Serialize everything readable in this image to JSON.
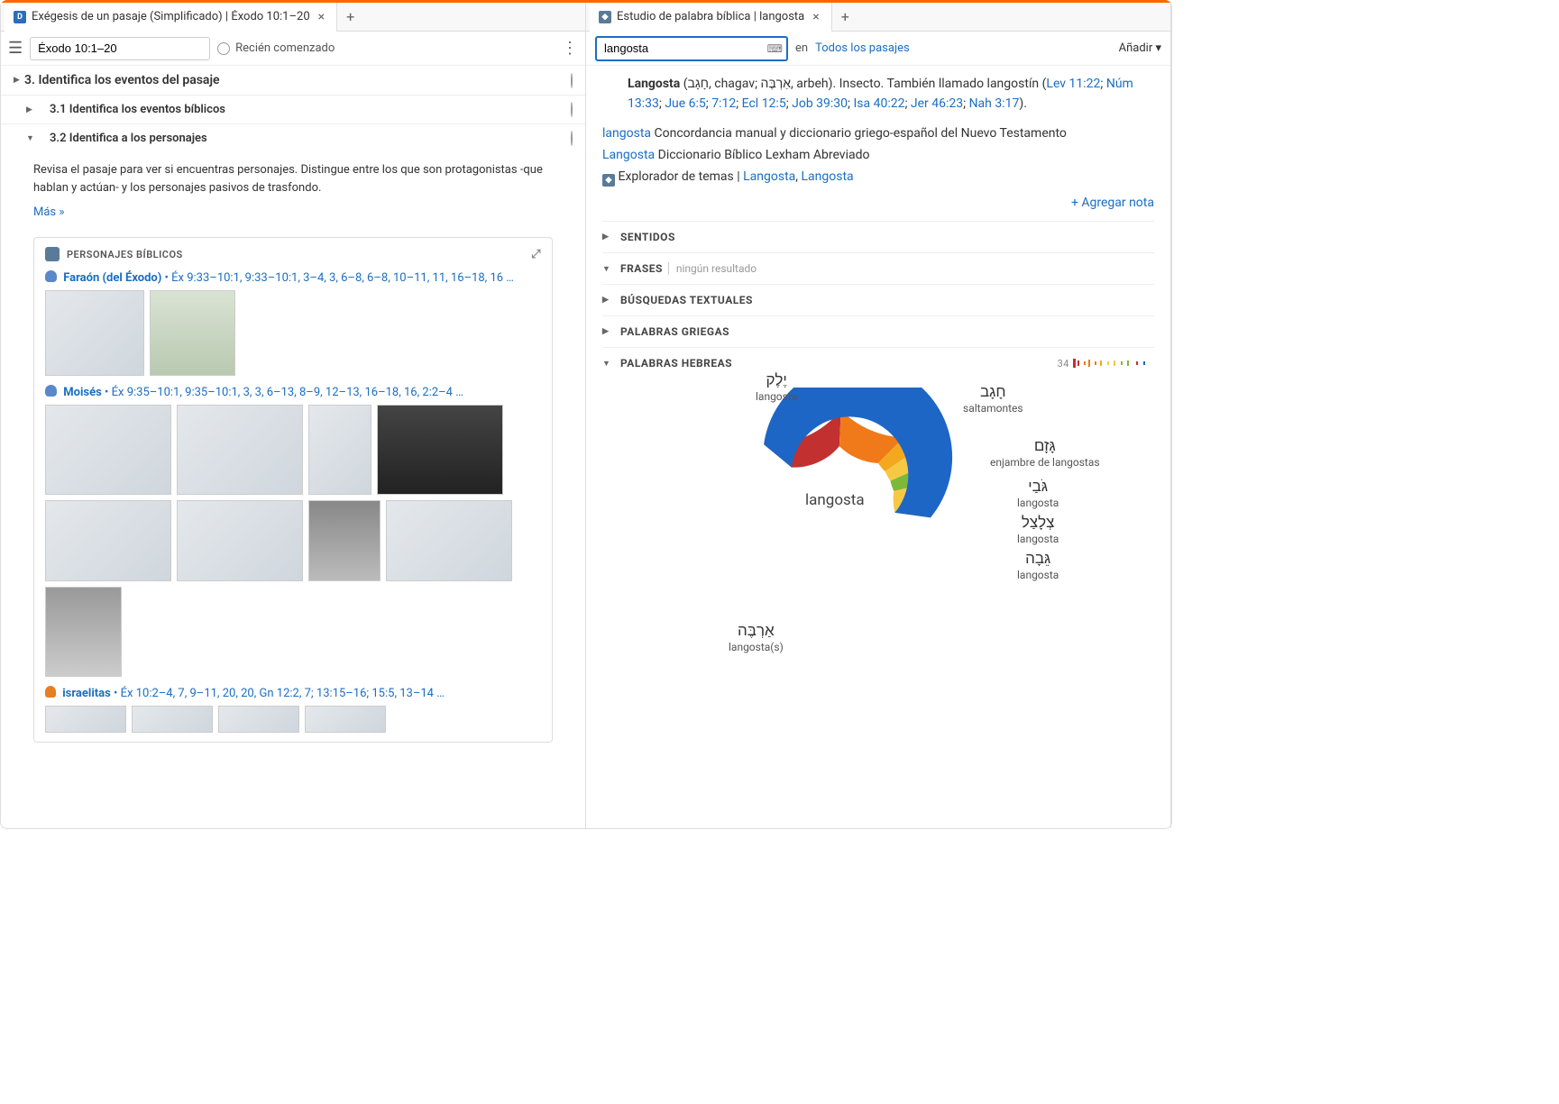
{
  "left": {
    "tab_title": "Exégesis de un pasaje (Simplificado) | Éxodo 10:1–20",
    "passage_input": "Éxodo 10:1–20",
    "status": "Recién comenzado",
    "sec3": "3. Identifica los eventos del pasaje",
    "sec31": "3.1 Identifica los eventos bíblicos",
    "sec32": "3.2 Identifica a los personajes",
    "body": "Revisa el pasaje para ver si encuentras personajes. Distingue entre los que son protagonistas -que hablan y actúan- y los personajes pasivos de trasfondo.",
    "more": "Más »",
    "card_title": "PERSONAJES BÍBLICOS",
    "faraon_name": "Faraón (del Éxodo)",
    "faraon_refs": " • Éx 9:33–10:1, 9:33–10:1, 3–4, 3, 6–8, 6–8, 10–11, 11, 16–18, 16 …",
    "moises_name": "Moisés",
    "moises_refs": " • Éx 9:35–10:1, 9:35–10:1, 3, 3, 6–13, 8–9, 12–13, 16–18, 16, 2:2–4 …",
    "israel_name": "israelitas",
    "israel_refs": " • Éx 10:2–4, 7, 9–11, 20, 20, Gn 12:2, 7; 13:15–16; 15:5, 13–14 …"
  },
  "right": {
    "tab_title": "Estudio de palabra bíblica | langosta",
    "search_value": "langosta",
    "en": "en",
    "all": "Todos los pasajes",
    "add": "Añadir ▾",
    "def_bold": "Langosta",
    "def_paren": " (חָגָב, chagav; אַרְבֶּה, arbeh). Insecto. También llamado langostín (",
    "def_links": [
      "Lev 11:22",
      "Núm 13:33",
      "Jue 6:5",
      "7:12",
      "Ecl 12:5",
      "Job 39:30",
      "Isa 40:22",
      "Jer 46:23",
      "Nah 3:17"
    ],
    "def_close": ").",
    "line_conc_link": "langosta",
    "line_conc_text": "  Concordancia manual y diccionario griego-español del Nuevo Testamento",
    "line_dic_link": "Langosta",
    "line_dic_text": "  Diccionario Bíblico Lexham Abreviado",
    "explorer_pre": "Explorador de temas | ",
    "explorer_l1": "Langosta",
    "explorer_l2": "Langosta",
    "add_note": "+ Agregar nota",
    "acc_sentidos": "SENTIDOS",
    "acc_frases": "FRASES",
    "acc_frases_sub": "ningún resultado",
    "acc_busq": "BÚSQUEDAS TEXTUALES",
    "acc_griegas": "PALABRAS GRIEGAS",
    "acc_hebreas": "PALABRAS HEBREAS",
    "spark_n": "34",
    "center": "langosta"
  },
  "chart_data": {
    "type": "pie",
    "title": "langosta",
    "series": [
      {
        "name": "אַרְבֶּה",
        "gloss": "langosta(s)",
        "value": 20,
        "color": "#1e66c6"
      },
      {
        "name": "יֶלֶק",
        "gloss": "langosta",
        "value": 5,
        "color": "#c23030"
      },
      {
        "name": "חָגָב",
        "gloss": "saltamontes",
        "value": 4,
        "color": "#f07a1a"
      },
      {
        "name": "גָּזָם",
        "gloss": "enjambre de langostas",
        "value": 1,
        "color": "#f4a81e"
      },
      {
        "name": "גֹּבַי",
        "gloss": "langosta",
        "value": 1,
        "color": "#f6c945"
      },
      {
        "name": "צְלָצַל",
        "gloss": "langosta",
        "value": 1,
        "color": "#7db83a"
      },
      {
        "name": "גֵּבָה",
        "gloss": "langosta",
        "value": 2,
        "color": "#f6c945"
      }
    ]
  }
}
